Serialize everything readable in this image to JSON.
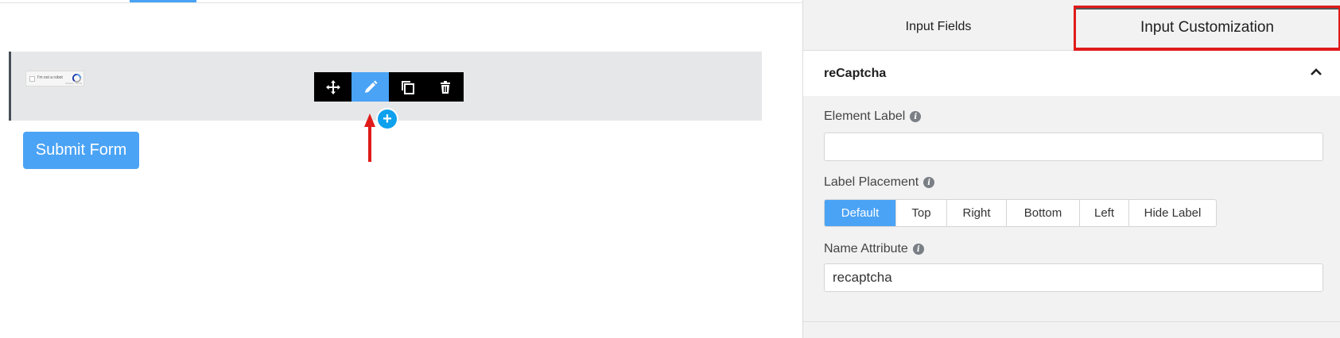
{
  "canvas": {
    "recaptcha": {
      "checkbox_text": "I'm not a robot",
      "sub_text": "Privacy - Terms"
    },
    "toolbar": {
      "tools": [
        "move-icon",
        "pencil-icon",
        "copy-icon",
        "trash-icon"
      ],
      "active_tool": "pencil-icon"
    },
    "add_button_label": "+",
    "submit_label": "Submit Form"
  },
  "panel": {
    "tabs": {
      "input_fields": "Input Fields",
      "input_customization": "Input Customization"
    },
    "section_title": "reCaptcha",
    "element_label": {
      "label": "Element Label",
      "value": ""
    },
    "label_placement": {
      "label": "Label Placement",
      "options": [
        "Default",
        "Top",
        "Right",
        "Bottom",
        "Left",
        "Hide Label"
      ],
      "selected": "Default"
    },
    "name_attribute": {
      "label": "Name Attribute",
      "value": "recaptcha"
    }
  },
  "colors": {
    "accent": "#4aa3f5",
    "add_button": "#0ea1ee",
    "highlight": "#e01b1b",
    "toolbar": "#000000"
  }
}
